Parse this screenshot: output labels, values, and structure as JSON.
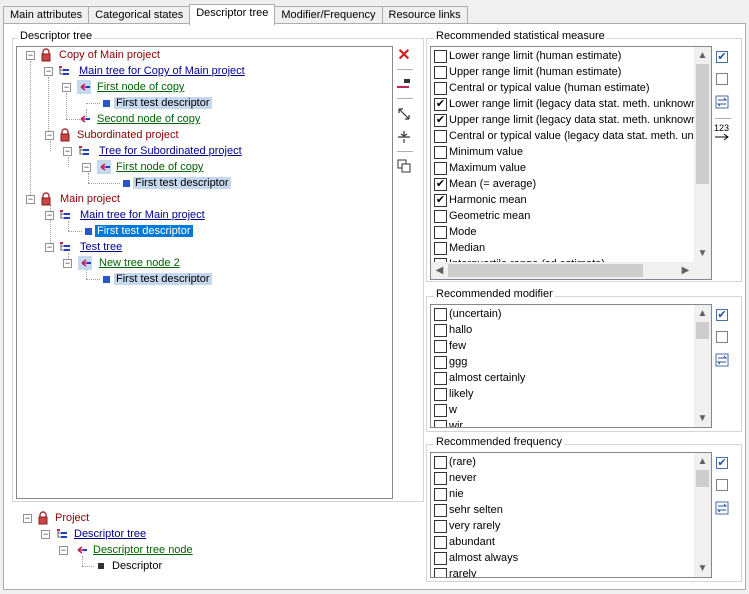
{
  "tabs": [
    "Main attributes",
    "Categorical states",
    "Descriptor tree",
    "Modifier/Frequency",
    "Resource links"
  ],
  "descriptor_tree": {
    "group_label": "Descriptor tree",
    "nodes": [
      "Copy of Main project",
      "Main tree for Copy of Main project",
      "First node of copy",
      "First test descriptor",
      "Second node of copy",
      "Subordinated project",
      "Tree for Subordinated project",
      "First node of copy",
      "First test descriptor",
      "Main project",
      "Main tree for Main project",
      "First test descriptor",
      "Test tree",
      "New tree node 2",
      "First test descriptor"
    ]
  },
  "legend": {
    "project": "Project",
    "descriptor_tree": "Descriptor tree",
    "descriptor_tree_node": "Descriptor tree node",
    "descriptor": "Descriptor"
  },
  "statistical": {
    "group_label": "Recommended statistical measure",
    "items": [
      {
        "label": "Lower range limit (human estimate)",
        "checked": false
      },
      {
        "label": "Upper range limit (human estimate)",
        "checked": false
      },
      {
        "label": "Central or typical value (human estimate)",
        "checked": false
      },
      {
        "label": "Lower range limit (legacy data stat. meth. unknown)",
        "checked": true
      },
      {
        "label": "Upper range limit (legacy data stat. meth. unknown)",
        "checked": true
      },
      {
        "label": "Central or typical value (legacy data stat. meth. unkn",
        "checked": false
      },
      {
        "label": "Minimum value",
        "checked": false
      },
      {
        "label": "Maximum value",
        "checked": false
      },
      {
        "label": "Mean (= average)",
        "checked": true
      },
      {
        "label": "Harmonic mean",
        "checked": true
      },
      {
        "label": "Geometric mean",
        "checked": false
      },
      {
        "label": "Mode",
        "checked": false
      },
      {
        "label": "Median",
        "checked": false
      },
      {
        "label": "Interquartile range (sd estimate)",
        "checked": false
      }
    ]
  },
  "modifier": {
    "group_label": "Recommended modifier",
    "items": [
      {
        "label": "(uncertain)",
        "checked": false
      },
      {
        "label": "hallo",
        "checked": false
      },
      {
        "label": "few",
        "checked": false
      },
      {
        "label": "ggg",
        "checked": false
      },
      {
        "label": "almost certainly",
        "checked": false
      },
      {
        "label": "likely",
        "checked": false
      },
      {
        "label": "w",
        "checked": false
      },
      {
        "label": "wir",
        "checked": false
      }
    ]
  },
  "frequency": {
    "group_label": "Recommended frequency",
    "items": [
      {
        "label": "(rare)",
        "checked": false
      },
      {
        "label": "never",
        "checked": false
      },
      {
        "label": "nie",
        "checked": false
      },
      {
        "label": "sehr selten",
        "checked": false
      },
      {
        "label": "very rarely",
        "checked": false
      },
      {
        "label": "abundant",
        "checked": false
      },
      {
        "label": "almost always",
        "checked": false
      },
      {
        "label": "rarely",
        "checked": false
      }
    ]
  },
  "sort_label": "123",
  "check_mark": "✔"
}
